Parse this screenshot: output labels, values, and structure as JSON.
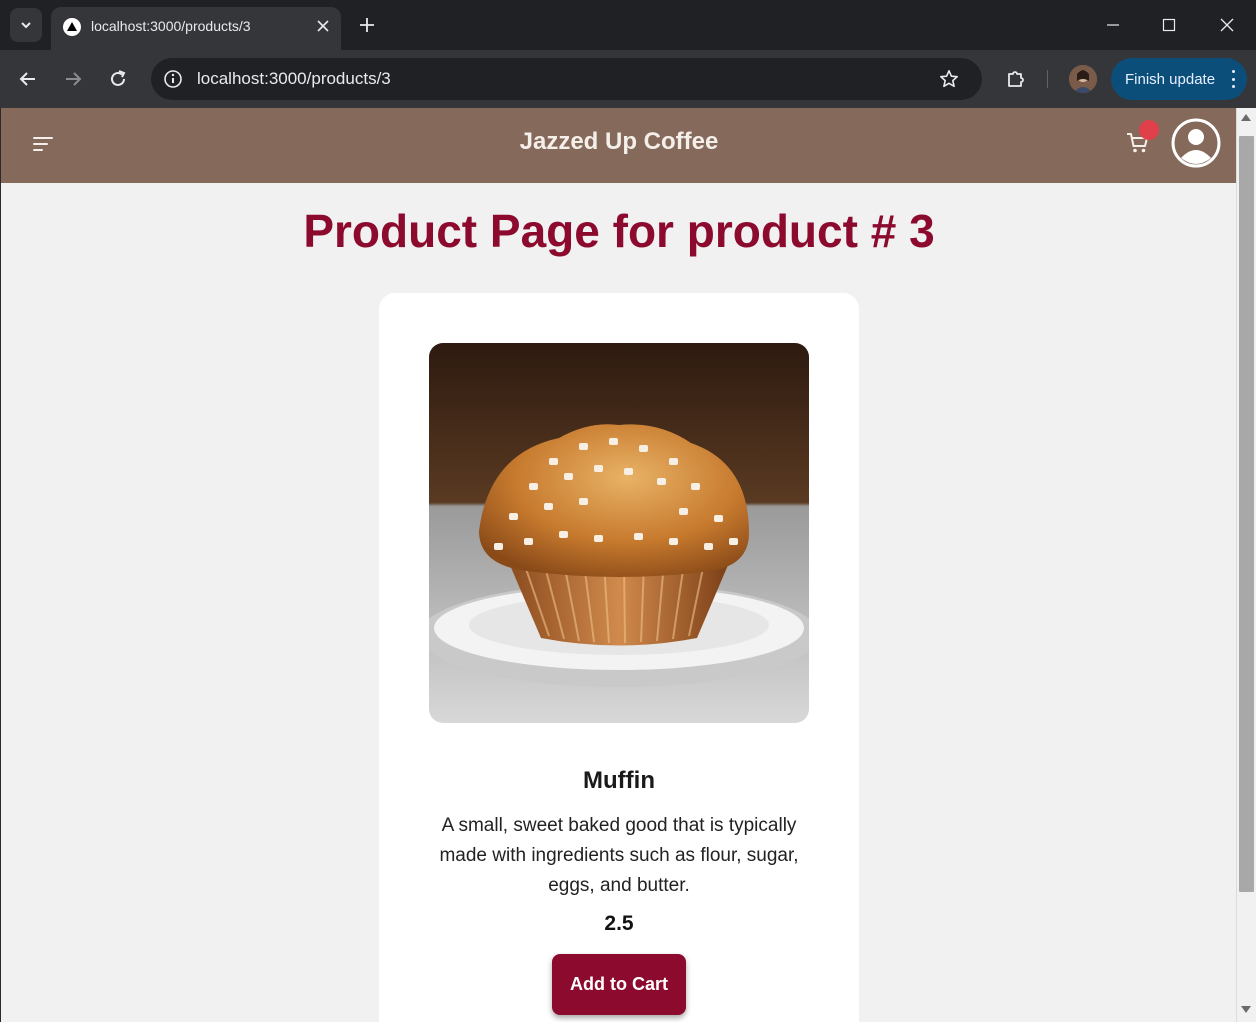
{
  "browser": {
    "tab_title": "localhost:3000/products/3",
    "url": "localhost:3000/products/3",
    "update_label": "Finish update"
  },
  "app": {
    "brand": "Jazzed Up Coffee",
    "page_title": "Product Page for product # 3"
  },
  "product": {
    "name": "Muffin",
    "description": "A small, sweet baked good that is typically made with ingredients such as flour, sugar, eggs, and butter.",
    "price": "2.5",
    "add_to_cart_label": "Add to Cart"
  },
  "colors": {
    "header": "#85695b",
    "accent": "#8c0a2e",
    "badge": "#e0404a",
    "background": "#f1f1f1"
  },
  "icons": [
    "tab-search-icon",
    "favicon-icon",
    "close-icon",
    "plus-icon",
    "minimize-icon",
    "maximize-icon",
    "window-close-icon",
    "back-icon",
    "forward-icon",
    "reload-icon",
    "site-info-icon",
    "star-icon",
    "extensions-icon",
    "menu-icon",
    "cart-icon",
    "user-avatar-icon"
  ]
}
